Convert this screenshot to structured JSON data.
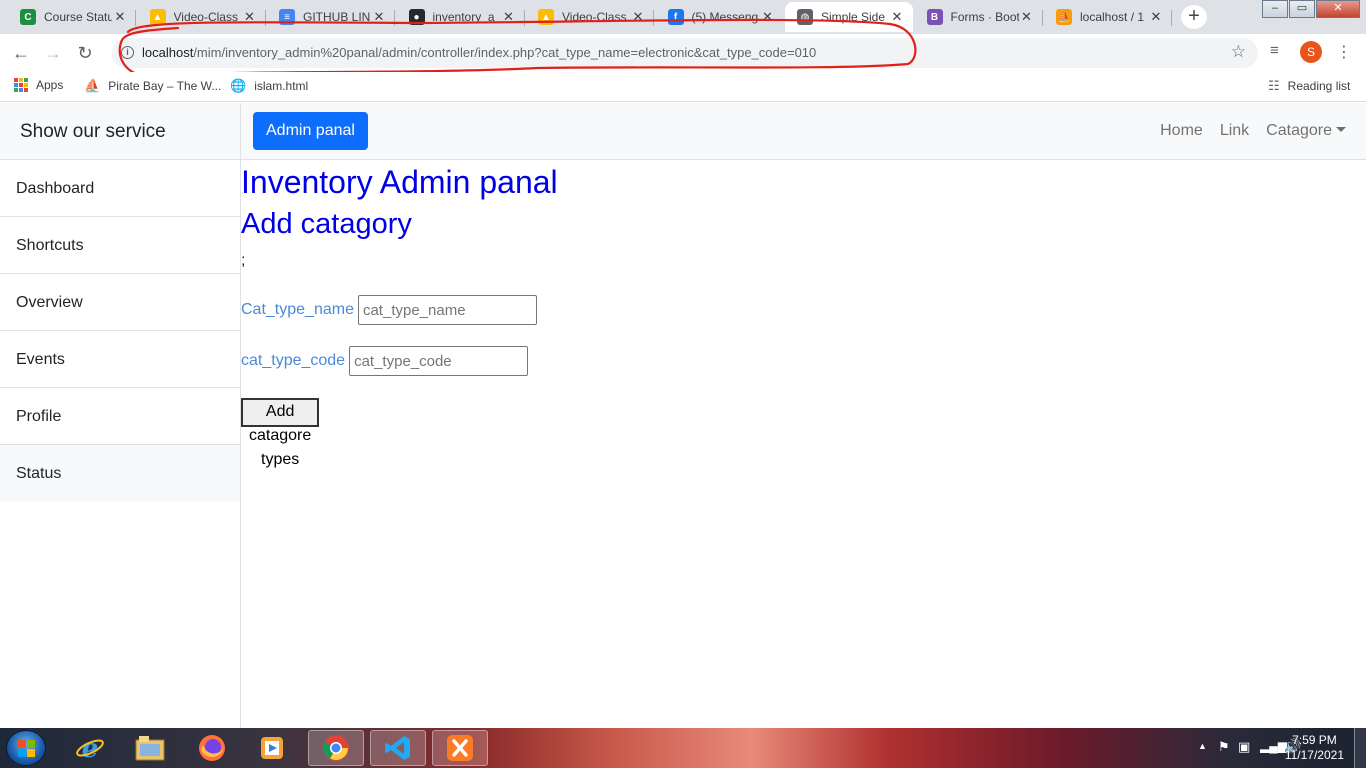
{
  "browser": {
    "tabs": [
      {
        "title": "Course Statu",
        "favicon": "course-icon",
        "color": "#1e8e3e"
      },
      {
        "title": "Video-Class",
        "favicon": "drive-icon",
        "color": "#fbbc04"
      },
      {
        "title": "GITHUB LIN",
        "favicon": "docs-icon",
        "color": "#4285f4"
      },
      {
        "title": "inventory_a",
        "favicon": "github-icon",
        "color": "#24292e"
      },
      {
        "title": "Video-Class",
        "favicon": "drive-icon",
        "color": "#fbbc04"
      },
      {
        "title": "(5) Messeng",
        "favicon": "facebook-icon",
        "color": "#1877f2"
      },
      {
        "title": "Simple Side",
        "favicon": "globe-icon",
        "color": "#5f6368"
      },
      {
        "title": "Forms · Boot",
        "favicon": "bootstrap-icon",
        "color": "#7952b3"
      },
      {
        "title": "localhost / 1",
        "favicon": "phpmyadmin-icon",
        "color": "#f89c0e"
      }
    ],
    "active_tab_index": 6,
    "url_host": "localhost",
    "url_path": "/mim/inventory_admin%20panal/admin/controller/index.php?cat_type_name=electronic&cat_type_code=010",
    "profile_initial": "S",
    "bookmarks": [
      {
        "label": "Apps"
      },
      {
        "label": "Pirate Bay – The W..."
      },
      {
        "label": "islam.html"
      }
    ],
    "reading_list": "Reading list"
  },
  "sidebar": {
    "brand": "Show our service",
    "items": [
      "Dashboard",
      "Shortcuts",
      "Overview",
      "Events",
      "Profile",
      "Status"
    ]
  },
  "topnav": {
    "button": "Admin panal",
    "links": [
      "Home",
      "Link"
    ],
    "dropdown": "Catagore"
  },
  "main": {
    "title": "Inventory Admin panal",
    "subtitle": "Add catagory",
    "stray_text": ";",
    "form": {
      "name_label": "Cat_type_name",
      "name_placeholder": "cat_type_name",
      "code_label": "cat_type_code",
      "code_placeholder": "cat_type_code",
      "submit": "Add catagore types"
    }
  },
  "taskbar": {
    "apps": [
      "internet-explorer-icon",
      "file-explorer-icon",
      "firefox-icon",
      "media-player-icon",
      "chrome-icon",
      "vscode-icon",
      "xampp-icon"
    ],
    "time": "7:59 PM",
    "date": "11/17/2021"
  },
  "colors": {
    "primary": "#0d6efd",
    "heading": "#0000e6",
    "label": "#4a8ad8",
    "annotation": "#e0201a"
  }
}
